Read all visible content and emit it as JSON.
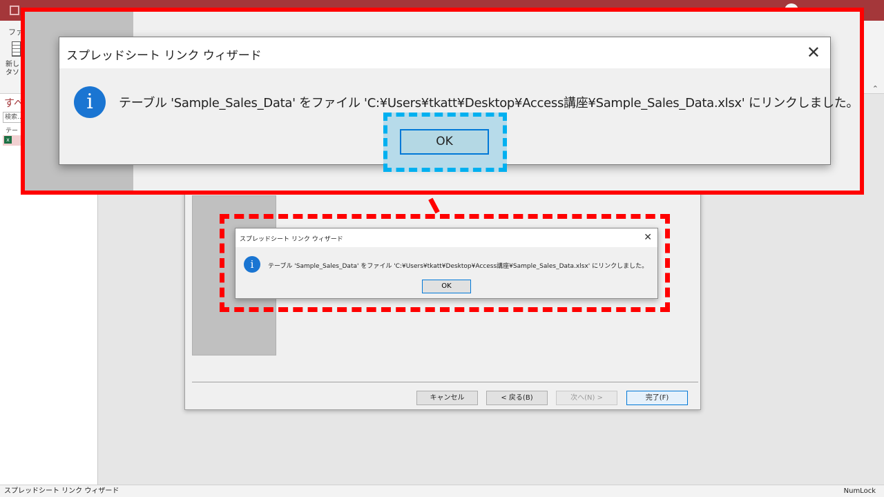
{
  "app": {
    "ribbon": {
      "file_tab": "ファ",
      "new_table_label_line1": "新し",
      "new_table_label_line2": "タソ"
    },
    "nav_pane": {
      "title": "すべ",
      "search_placeholder": "検索...",
      "group_label": "テー",
      "item_icon": "excel-linked-table-icon"
    },
    "status_bar": {
      "left": "スプレッドシート リンク ウィザード",
      "right": "NumLock"
    }
  },
  "wizard": {
    "buttons": {
      "cancel": "キャンセル",
      "back": "< 戻る(B)",
      "next": "次へ(N) >",
      "finish": "完了(F)"
    }
  },
  "dialog": {
    "title": "スプレッドシート リンク ウィザード",
    "message": "テーブル 'Sample_Sales_Data' をファイル 'C:¥Users¥tkatt¥Desktop¥Access講座¥Sample_Sales_Data.xlsx' にリンクしました。",
    "ok_label": "OK",
    "close_symbol": "✕",
    "info_symbol": "i"
  },
  "colors": {
    "highlight_frame": "#ff0000",
    "ok_highlight": "#00b0f0",
    "info_icon": "#1a75d2",
    "title_bar": "#a4373a"
  }
}
